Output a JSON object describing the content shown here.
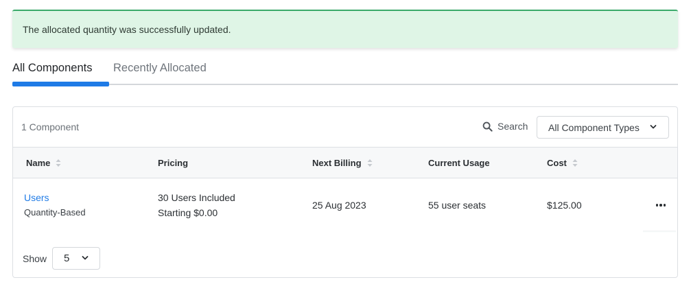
{
  "alert": {
    "message": "The allocated quantity was successfully updated."
  },
  "tabs": [
    {
      "label": "All Components",
      "active": true
    },
    {
      "label": "Recently Allocated",
      "active": false
    }
  ],
  "toolbar": {
    "count": "1 Component",
    "search_label": "Search",
    "type_filter": "All Component Types"
  },
  "table": {
    "columns": [
      "Name",
      "Pricing",
      "Next Billing",
      "Current Usage",
      "Cost"
    ],
    "rows": [
      {
        "name": "Users",
        "type": "Quantity-Based",
        "pricing_line1": "30 Users Included",
        "pricing_line2": "Starting $0.00",
        "next_billing": "25 Aug 2023",
        "current_usage": "55 user seats",
        "cost": "$125.00"
      }
    ]
  },
  "pagination": {
    "show_label": "Show",
    "page_size": "5"
  },
  "colors": {
    "accent": "#1f7be6",
    "success_bg": "#dff5e6",
    "success_border": "#3aaa6a"
  },
  "icons": [
    "search-icon",
    "chevron-down-icon",
    "sort-icon",
    "more-horizontal-icon"
  ]
}
